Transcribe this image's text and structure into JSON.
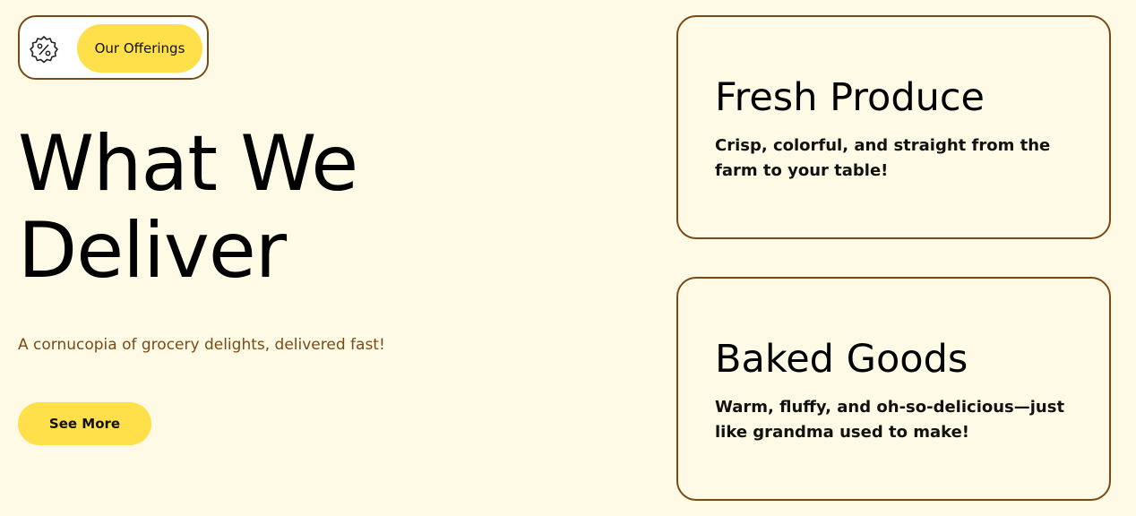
{
  "badge": {
    "icon": "percent-badge-icon",
    "label": "Our Offerings"
  },
  "hero": {
    "title": "What We Deliver",
    "tagline": "A cornucopia of grocery delights, delivered fast!",
    "cta_label": "See More"
  },
  "cards": [
    {
      "title": "Fresh Produce",
      "description": "Crisp, colorful, and straight from the farm to your table!"
    },
    {
      "title": "Baked Goods",
      "description": "Warm, fluffy, and oh-so-delicious—just like grandma used to make!"
    }
  ],
  "colors": {
    "background": "#fefae6",
    "accent": "#ffe04a",
    "border": "#7a4a14"
  }
}
